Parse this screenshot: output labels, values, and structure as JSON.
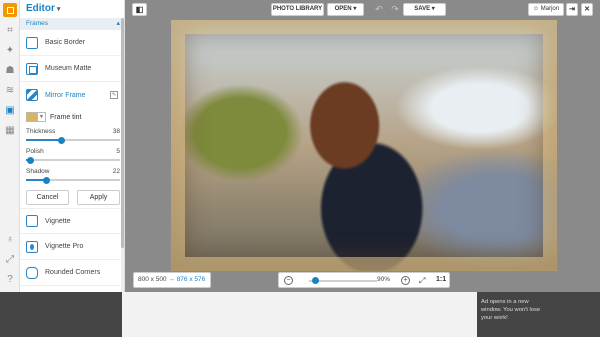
{
  "app": {
    "title": "Editor"
  },
  "panel": {
    "section": "Frames",
    "items_top": [
      {
        "label": "Basic Border",
        "thumb": "square"
      },
      {
        "label": "Museum Matte",
        "thumb": "inner"
      }
    ],
    "active_item": {
      "label": "Mirror Frame",
      "thumb": "mirror"
    },
    "tint_label": "Frame tint",
    "tint_color": "#d7b46a",
    "sliders": [
      {
        "label": "Thickness",
        "value": 38,
        "max": 100
      },
      {
        "label": "Polish",
        "value": 5,
        "max": 100
      },
      {
        "label": "Shadow",
        "value": 22,
        "max": 100
      }
    ],
    "cancel_label": "Cancel",
    "apply_label": "Apply",
    "items_bottom": [
      {
        "label": "Vignette",
        "thumb": "square"
      },
      {
        "label": "Vignette Pro",
        "thumb": "drop"
      },
      {
        "label": "Rounded Corners",
        "thumb": "round"
      }
    ]
  },
  "toolbar": {
    "photo_library": "PHOTO LIBRARY",
    "open": "OPEN",
    "save": "SAVE",
    "user": "Marjon"
  },
  "status": {
    "original_size": "800 x 500",
    "arrow": "→",
    "new_size": "876 x 576",
    "zoom_percent": "90%",
    "zoom_value": 0.9,
    "one_to_one": "1:1"
  },
  "ad": {
    "note": "Ad opens in a new window. You won't lose your work!"
  },
  "colors": {
    "accent": "#1a82c3",
    "logo": "#f29700",
    "frame": "#d3aa5e"
  }
}
